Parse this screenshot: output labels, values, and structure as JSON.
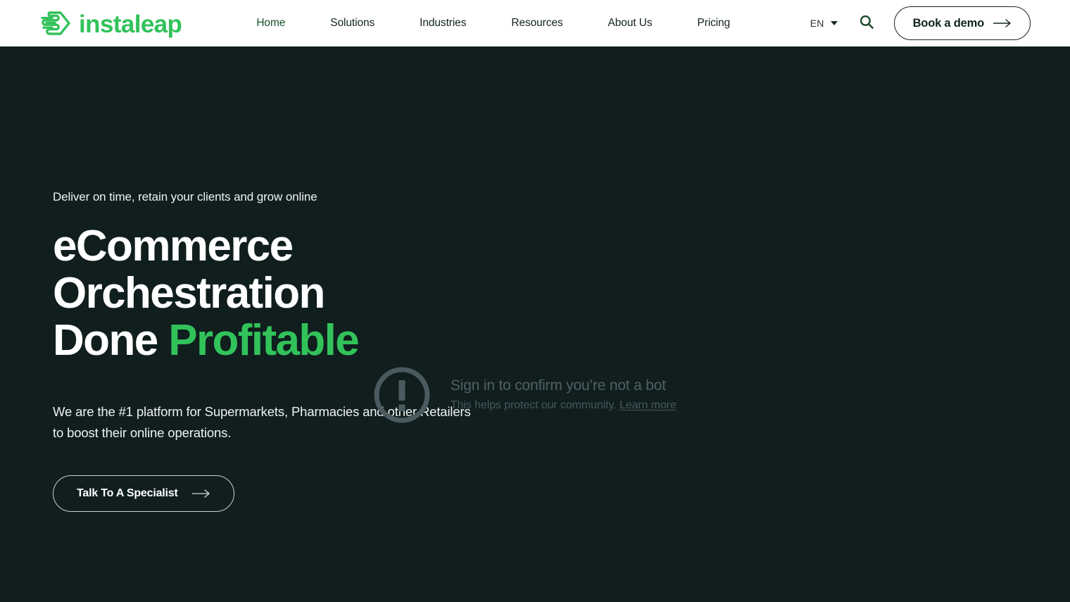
{
  "colors": {
    "brand_green": "#32c25a",
    "header_bg": "#ffffff",
    "hero_bg": "#101e1e",
    "hero_text": "#ffffff",
    "overlay_muted": "#4f6166"
  },
  "header": {
    "logo": {
      "icon": "instaleap-chevron-lines-icon",
      "wordmark": "instaleap"
    },
    "nav": [
      {
        "label": "Home",
        "active": true
      },
      {
        "label": "Solutions",
        "active": false
      },
      {
        "label": "Industries",
        "active": false
      },
      {
        "label": "Resources",
        "active": false
      },
      {
        "label": "About Us",
        "active": false
      },
      {
        "label": "Pricing",
        "active": false
      }
    ],
    "language": {
      "value": "EN",
      "caret_icon": "chevron-down-icon"
    },
    "search": {
      "icon": "search-icon"
    },
    "demo_button": {
      "label": "Book a demo",
      "icon": "arrow-right-icon"
    }
  },
  "hero": {
    "eyebrow": "Deliver on time, retain your clients and grow online",
    "headline_line1": "eCommerce",
    "headline_line2": "Orchestration",
    "headline_line3_plain": "Done",
    "headline_line3_accent": "Profitable",
    "subcopy_line1": "We are the #1 platform for Supermarkets, Pharmacies and other Retailers",
    "subcopy_line2": "to boost their online operations.",
    "cta": {
      "label": "Talk To A Specialist",
      "icon": "arrow-right-icon"
    }
  },
  "bot_check": {
    "icon": "exclamation-circle-icon",
    "title": "Sign in to confirm you’re not a bot",
    "subtitle": "This helps protect our community.",
    "link_label": "Learn more"
  }
}
